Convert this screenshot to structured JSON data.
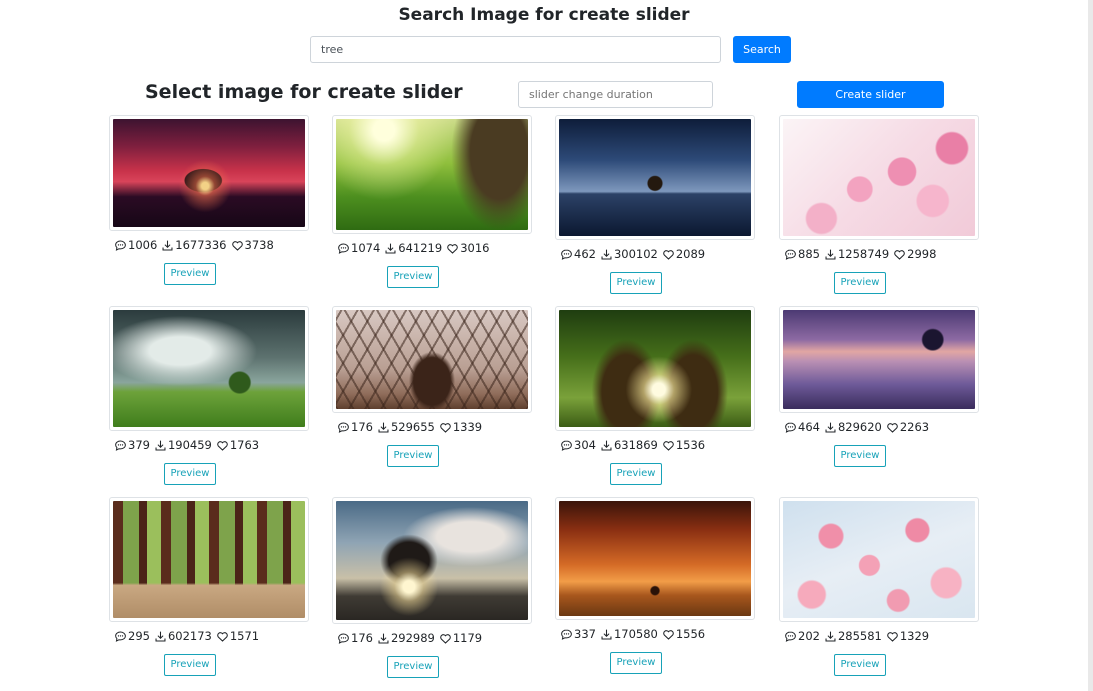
{
  "header": {
    "title": "Search Image for create slider"
  },
  "search": {
    "value": "tree",
    "button_label": "Search"
  },
  "slider_form": {
    "section_title": "Select image for create slider",
    "duration_placeholder": "slider change duration",
    "create_button_label": "Create slider"
  },
  "preview_label": "Preview",
  "images": [
    {
      "comments": "1006",
      "downloads": "1677336",
      "likes": "3738"
    },
    {
      "comments": "1074",
      "downloads": "641219",
      "likes": "3016"
    },
    {
      "comments": "462",
      "downloads": "300102",
      "likes": "2089"
    },
    {
      "comments": "885",
      "downloads": "1258749",
      "likes": "2998"
    },
    {
      "comments": "379",
      "downloads": "190459",
      "likes": "1763"
    },
    {
      "comments": "176",
      "downloads": "529655",
      "likes": "1339"
    },
    {
      "comments": "304",
      "downloads": "631869",
      "likes": "1536"
    },
    {
      "comments": "464",
      "downloads": "829620",
      "likes": "2263"
    },
    {
      "comments": "295",
      "downloads": "602173",
      "likes": "1571"
    },
    {
      "comments": "176",
      "downloads": "292989",
      "likes": "1179"
    },
    {
      "comments": "337",
      "downloads": "170580",
      "likes": "1556"
    },
    {
      "comments": "202",
      "downloads": "285581",
      "likes": "1329"
    }
  ]
}
